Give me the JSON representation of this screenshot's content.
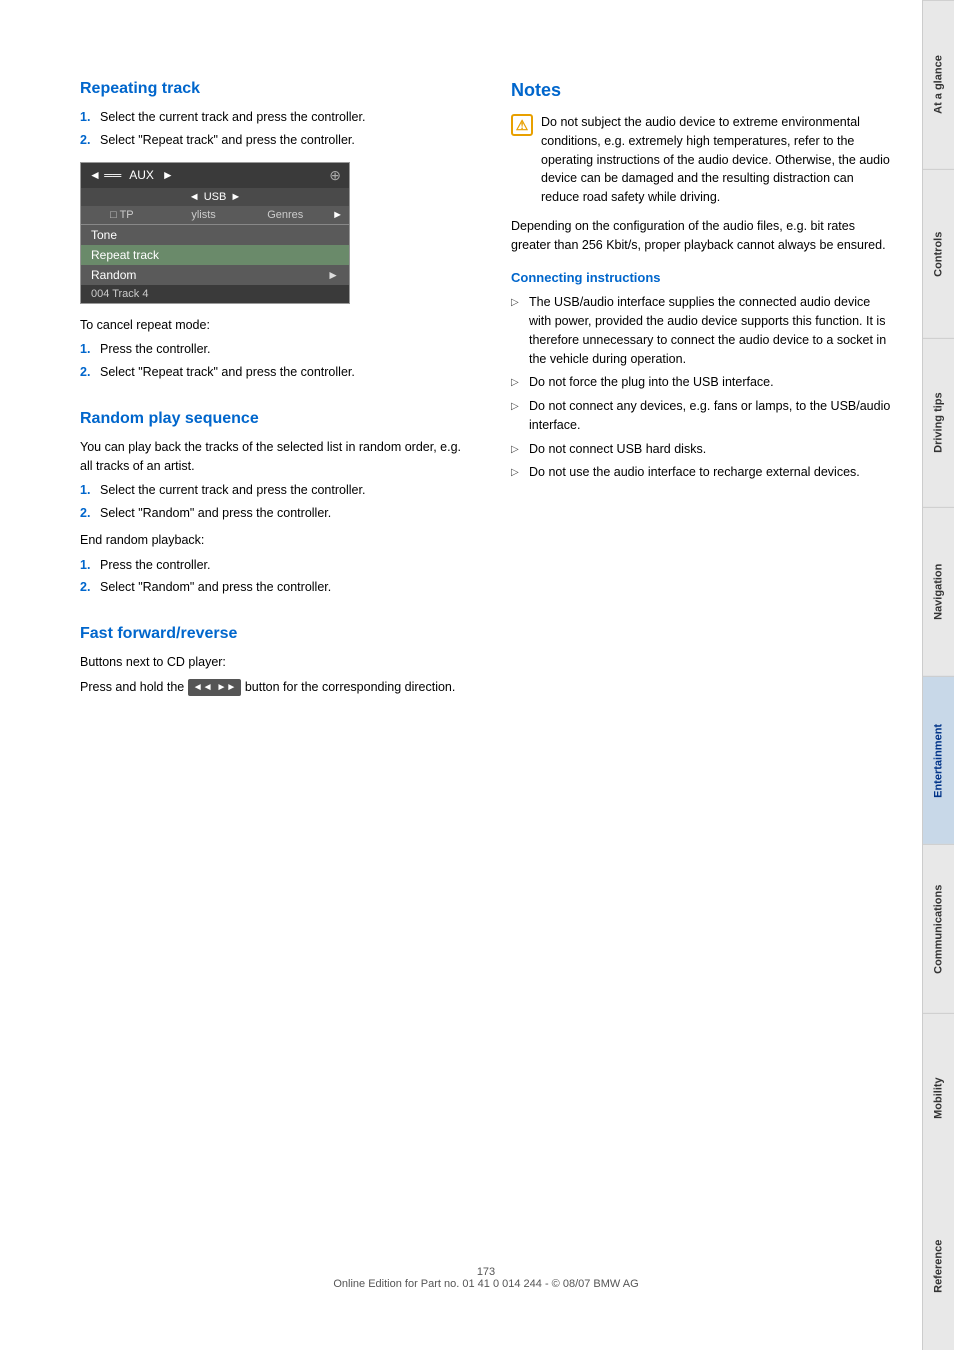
{
  "page": {
    "number": "173",
    "footer_text": "Online Edition for Part no. 01 41 0 014 244 - © 08/07 BMW AG"
  },
  "sidebar": {
    "tabs": [
      {
        "id": "at-a-glance",
        "label": "At a glance",
        "active": false
      },
      {
        "id": "controls",
        "label": "Controls",
        "active": false
      },
      {
        "id": "driving-tips",
        "label": "Driving tips",
        "active": false
      },
      {
        "id": "navigation",
        "label": "Navigation",
        "active": false
      },
      {
        "id": "entertainment",
        "label": "Entertainment",
        "active": true
      },
      {
        "id": "communications",
        "label": "Communications",
        "active": false
      },
      {
        "id": "mobility",
        "label": "Mobility",
        "active": false
      },
      {
        "id": "reference",
        "label": "Reference",
        "active": false
      }
    ]
  },
  "repeating_track": {
    "title": "Repeating track",
    "steps": [
      {
        "num": "1.",
        "text": "Select the current track and press the controller."
      },
      {
        "num": "2.",
        "text": "Select \"Repeat track\" and press the controller."
      }
    ],
    "ui_screen": {
      "header_left": "◄",
      "header_center": "AUX",
      "header_right": "►",
      "header_icon": "⊕",
      "sub_left": "◄",
      "sub_center": "USB",
      "sub_right": "►",
      "tabs": [
        "ylists",
        "Genres"
      ],
      "tab_arrow": "►",
      "menu_items": [
        {
          "label": "TP",
          "type": "checkbox",
          "selected": false
        },
        {
          "label": "Tone",
          "selected": false
        },
        {
          "label": "Repeat track",
          "selected": true
        },
        {
          "label": "Random",
          "arrow": "►",
          "selected": false
        }
      ],
      "track_bar": "004 Track 4"
    },
    "cancel_repeat_label": "To cancel repeat mode:",
    "cancel_steps": [
      {
        "num": "1.",
        "text": "Press the controller."
      },
      {
        "num": "2.",
        "text": "Select \"Repeat track\" and press the controller."
      }
    ]
  },
  "random_play": {
    "title": "Random play sequence",
    "intro": "You can play back the tracks of the selected list in random order, e.g. all tracks of an artist.",
    "steps": [
      {
        "num": "1.",
        "text": "Select the current track and press the controller."
      },
      {
        "num": "2.",
        "text": "Select \"Random\" and press the controller."
      }
    ],
    "end_random_label": "End random playback:",
    "end_steps": [
      {
        "num": "1.",
        "text": "Press the controller."
      },
      {
        "num": "2.",
        "text": "Select \"Random\" and press the controller."
      }
    ]
  },
  "fast_forward": {
    "title": "Fast forward/reverse",
    "buttons_label": "Buttons next to CD player:",
    "instruction": "Press and hold the",
    "button_label": "◄◄ ►►",
    "instruction_end": "button for the corresponding direction."
  },
  "notes": {
    "title": "Notes",
    "warning_text": "Do not subject the audio device to extreme environmental conditions, e.g. extremely high temperatures, refer to the operating instructions of the audio device. Otherwise, the audio device can be damaged and the resulting distraction can reduce road safety while driving.",
    "para2": "Depending on the configuration of the audio files, e.g. bit rates greater than 256 Kbit/s, proper playback cannot always be ensured.",
    "connecting_instructions": {
      "title": "Connecting instructions",
      "bullets": [
        "The USB/audio interface supplies the connected audio device with power, provided the audio device supports this function. It is therefore unnecessary to connect the audio device to a socket in the vehicle during operation.",
        "Do not force the plug into the USB interface.",
        "Do not connect any devices, e.g. fans or lamps, to the USB/audio interface.",
        "Do not connect USB hard disks.",
        "Do not use the audio interface to recharge external devices."
      ]
    }
  }
}
